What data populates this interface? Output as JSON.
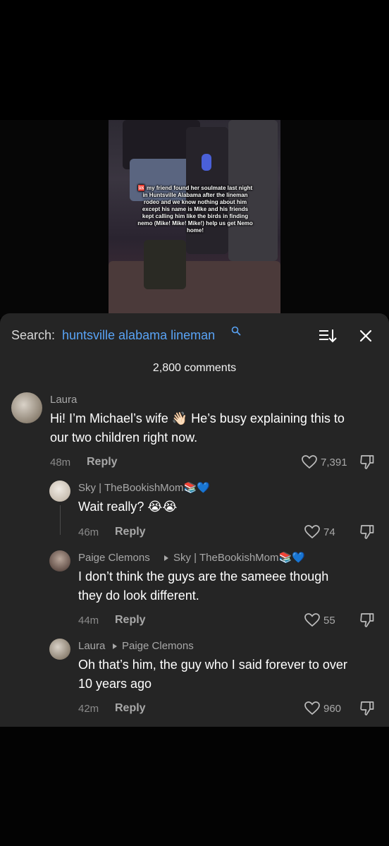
{
  "video": {
    "caption": "🆘 my friend found her soulmate last night in Huntsville Alabama after the lineman rodeo and we know nothing about him except his name is Mike and his friends kept calling him like the birds in finding nemo (Mike! Mike! Mike!) help us get Nemo home!"
  },
  "search": {
    "label": "Search:",
    "term": "huntsville alabama lineman"
  },
  "comments_count": "2,800 comments",
  "comments": [
    {
      "username": "Laura",
      "text_line1": "Hi! I’m Michael’s wife 👋🏻 He’s busy explaining this to",
      "text_line2": "our two children right now.",
      "time": "48m",
      "reply": "Reply",
      "likes": "7,391"
    },
    {
      "username": "Sky | TheBookishMom📚💙",
      "text": "Wait really? 😭😭",
      "time": "46m",
      "reply": "Reply",
      "likes": "74"
    },
    {
      "username": "Paige Clemons",
      "reply_to": "Sky | TheBookishMom📚💙",
      "text_line1": "I don’t think the guys are the sameee though",
      "text_line2": "they do look different.",
      "time": "44m",
      "reply": "Reply",
      "likes": "55"
    },
    {
      "username": "Laura",
      "reply_to": "Paige Clemons",
      "text_line1": "Oh that’s him, the guy who I said forever to over",
      "text_line2": "10 years ago",
      "time": "42m",
      "reply": "Reply",
      "likes": "960"
    }
  ],
  "colors": {
    "panel_bg": "#252525",
    "search_term": "#59a3f5"
  }
}
